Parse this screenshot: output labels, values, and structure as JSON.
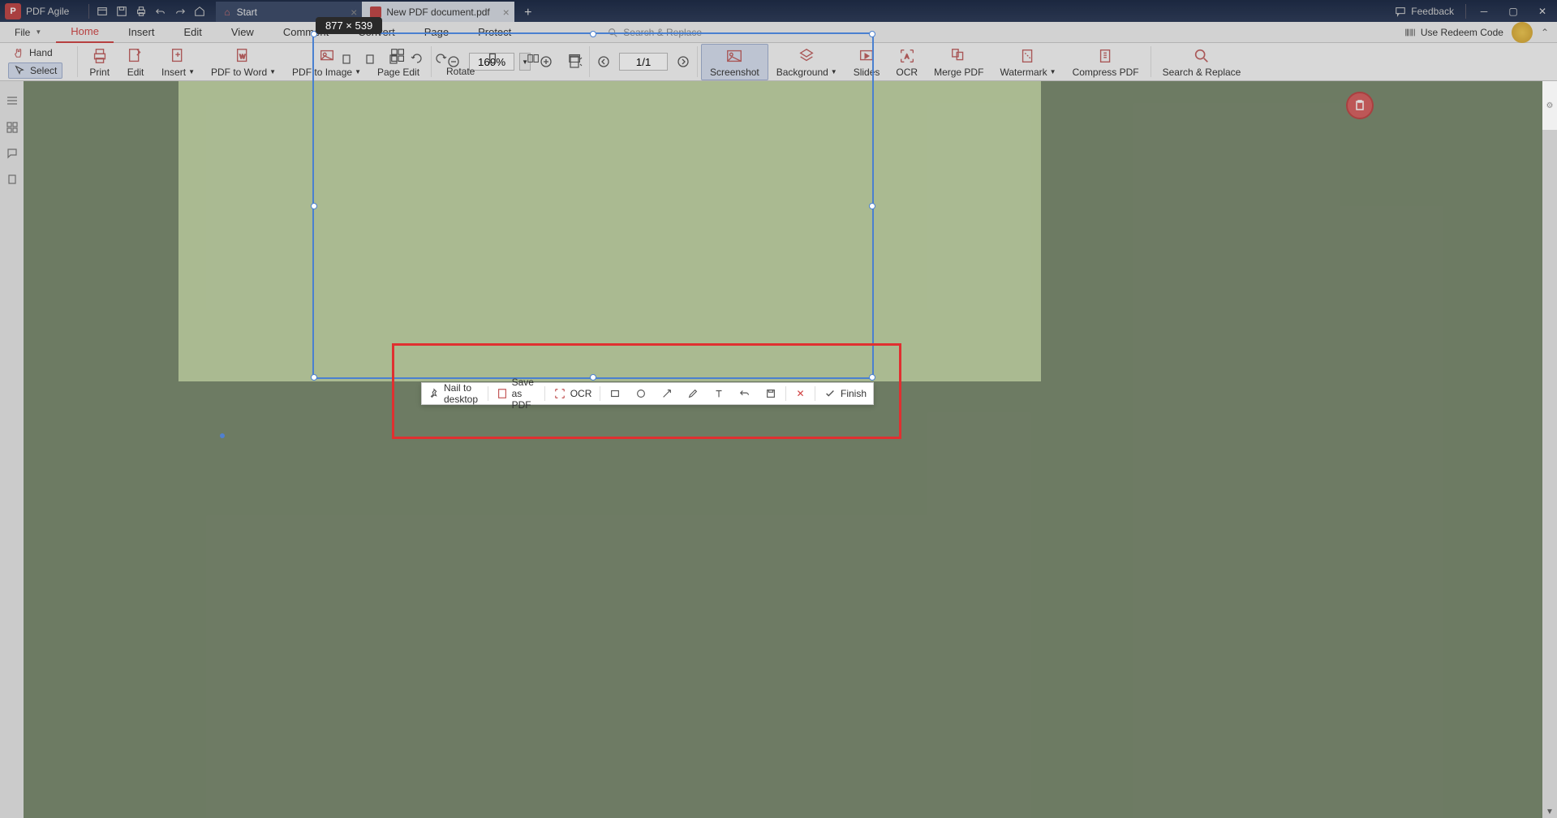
{
  "titlebar": {
    "app_name": "PDF Agile",
    "feedback_label": "Feedback"
  },
  "tabs": {
    "start_label": "Start",
    "pdf_label": "New PDF document.pdf"
  },
  "menubar": {
    "file": "File",
    "items": [
      "Home",
      "Insert",
      "Edit",
      "View",
      "Comment",
      "Convert",
      "Page",
      "Protect"
    ],
    "active_index": 0,
    "search_replace": "Search & Replace",
    "redeem_code": "Use Redeem Code"
  },
  "ribbon": {
    "hand": "Hand",
    "select": "Select",
    "print": "Print",
    "edit": "Edit",
    "insert": "Insert",
    "pdf_to_word": "PDF to Word",
    "pdf_to_image": "PDF to Image",
    "page_edit": "Page Edit",
    "zoom_value": "169%",
    "page_value": "1/1",
    "rotate": "Rotate",
    "screenshot": "Screenshot",
    "background": "Background",
    "slides": "Slides",
    "ocr": "OCR",
    "merge_pdf": "Merge PDF",
    "watermark": "Watermark",
    "compress_pdf": "Compress PDF",
    "search_replace": "Search & Replace"
  },
  "selection": {
    "dimensions": "877 × 539"
  },
  "screenshot_toolbar": {
    "nail": "Nail to desktop",
    "save_pdf": "Save as PDF",
    "ocr": "OCR",
    "finish": "Finish"
  }
}
